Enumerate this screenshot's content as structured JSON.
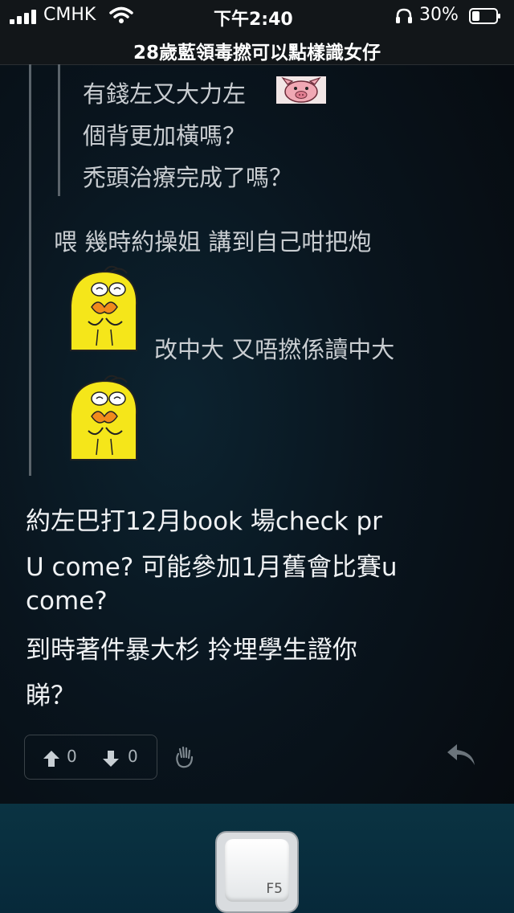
{
  "status_bar": {
    "carrier": "CMHK",
    "time": "下午2:40",
    "battery": "30%",
    "icons": [
      "signal-icon",
      "wifi-icon",
      "headphones-icon",
      "battery-icon"
    ]
  },
  "header": {
    "title": "28歲藍領毒撚可以點樣識女仔"
  },
  "quote": {
    "nested_lines": [
      "有錢左又大力左",
      "個背更加橫嗎？",
      "禿頭治療完成了嗎？"
    ],
    "line": "喂 幾時約操姐 講到自己咁把炮",
    "caption": "改中大 又唔撚係讀中大"
  },
  "message": {
    "lines": [
      "約左巴打12月book 場check pr",
      "U come? 可能參加1月舊會比賽u",
      "come?",
      "到時著件暴大杉 拎埋學生證你",
      "睇？"
    ]
  },
  "actions": {
    "upvotes": "0",
    "downvotes": "0",
    "icons": [
      "thumb-up-icon",
      "thumb-down-icon",
      "hand-icon",
      "reply-icon"
    ]
  },
  "footer": {
    "refresh_key_label": "F5"
  },
  "colors": {
    "background": "#09141d",
    "bar": "#121619",
    "footer": "#07293a"
  }
}
